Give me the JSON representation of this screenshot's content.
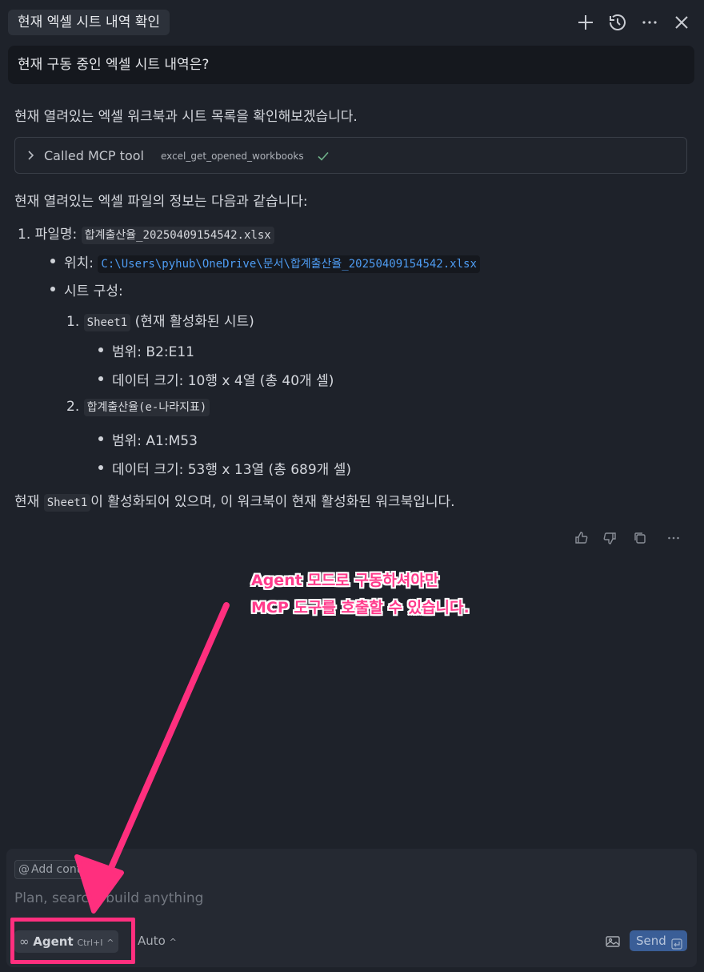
{
  "header": {
    "title": "현재 엑셀 시트 내역 확인",
    "icons": [
      "plus-icon",
      "history-icon",
      "more-icon",
      "close-icon"
    ]
  },
  "user_message": "현재 구동 중인 엑셀 시트 내역은?",
  "response": {
    "intro": "현재 열려있는 엑셀 워크북과 시트 목록을 확인해보겠습니다.",
    "tool_call": {
      "label": "Called MCP tool",
      "name": "excel_get_opened_workbooks"
    },
    "info_heading": "현재 열려있는 엑셀 파일의 정보는 다음과 같습니다:",
    "file": {
      "num": "1.",
      "label": "파일명:",
      "name": "합계출산율_20250409154542.xlsx",
      "location_label": "위치:",
      "location": "C:\\Users\\pyhub\\OneDrive\\문서\\합계출산율_20250409154542.xlsx",
      "sheets_label": "시트 구성:",
      "sheets": [
        {
          "num": "1.",
          "name": "Sheet1",
          "note": "(현재 활성화된 시트)",
          "range": "범위: B2:E11",
          "size": "데이터 크기: 10행 x 4열 (총 40개 셀)"
        },
        {
          "num": "2.",
          "name": "합계출산율(e-나라지표)",
          "note": "",
          "range": "범위: A1:M53",
          "size": "데이터 크기: 53행 x 13열 (총 689개 셀)"
        }
      ]
    },
    "closing_prefix": "현재 ",
    "closing_code": "Sheet1",
    "closing_suffix": "이 활성화되어 있으며, 이 워크북이 현재 활성화된 워크북입니다."
  },
  "annotation": {
    "line1": "Agent 모드로 구동하셔야만",
    "line2": "MCP 도구를 호출할 수 있습니다.",
    "color": "#ff2f7e"
  },
  "composer": {
    "add_context": "Add cont",
    "placeholder": "Plan, search, build anything",
    "mode_label": "Agent",
    "mode_shortcut": "Ctrl+I",
    "model_label": "Auto",
    "send_label": "Send"
  }
}
